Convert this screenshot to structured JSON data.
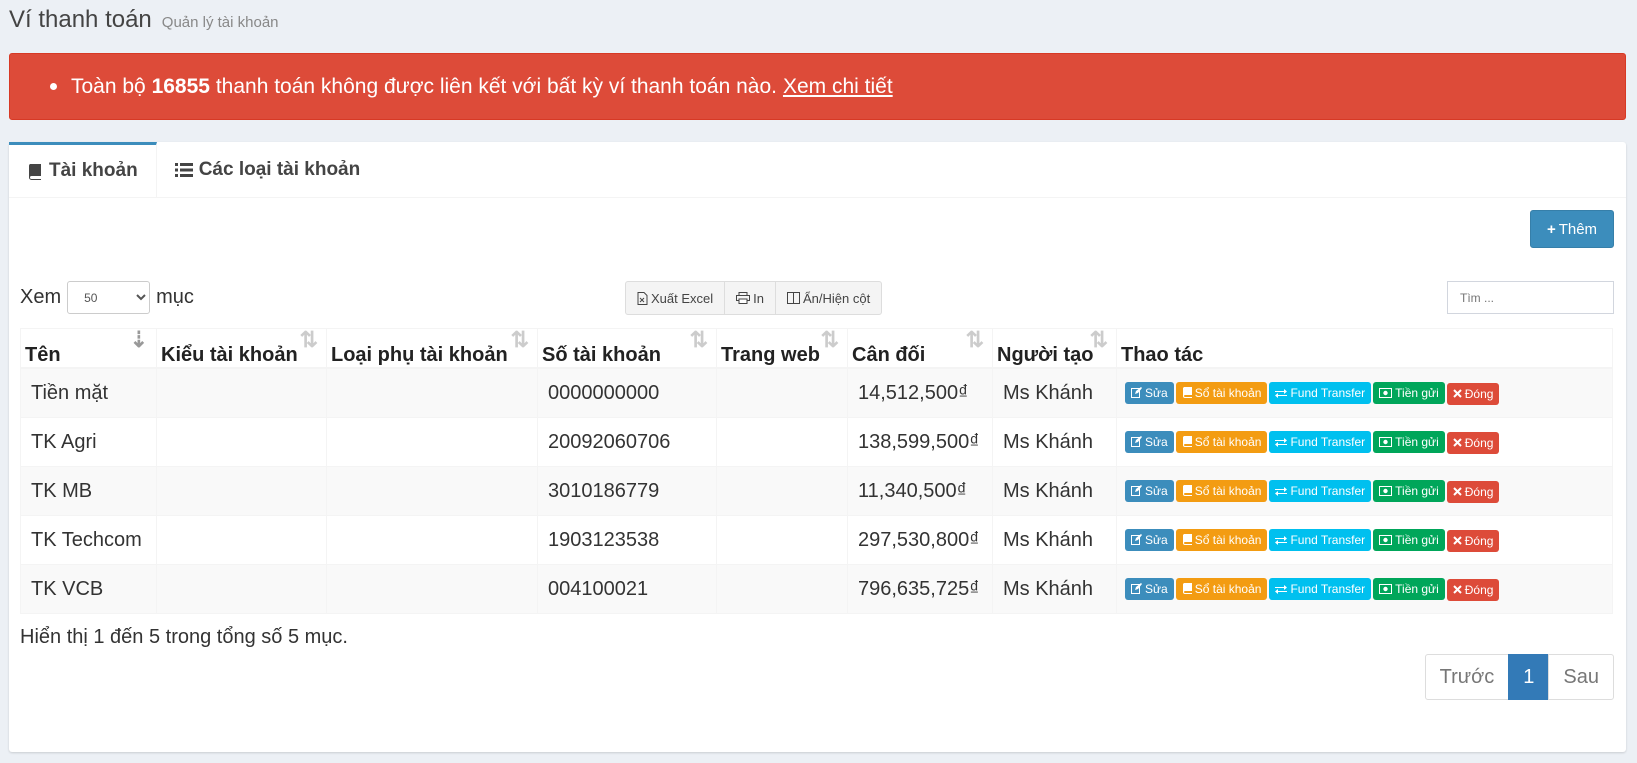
{
  "header": {
    "title": "Ví thanh toán",
    "subtitle": "Quản lý tài khoản"
  },
  "alert": {
    "before": "Toàn bộ",
    "count": "16855",
    "after": "thanh toán không được liên kết với bất kỳ ví thanh toán nào.",
    "link": "Xem chi tiết",
    "color": "#dd4b39"
  },
  "tabs": [
    {
      "label": "Tài khoản",
      "icon": "book-icon"
    },
    {
      "label": "Các loại tài khoản",
      "icon": "list-icon"
    }
  ],
  "add_button": "Thêm",
  "length": {
    "prefix": "Xem",
    "value": "50",
    "suffix": "mục"
  },
  "export_buttons": {
    "excel": "Xuất Excel",
    "print": "In",
    "columns": "Ẩn/Hiện cột"
  },
  "search": {
    "placeholder": "Tìm ..."
  },
  "table": {
    "headers": [
      "Tên",
      "Kiểu tài khoản",
      "Loại phụ tài khoản",
      "Số tài khoản",
      "Trang web",
      "Cân đối",
      "Người tạo",
      "Thao tác"
    ],
    "rows": [
      {
        "name": "Tiền mặt",
        "type": "",
        "subtype": "",
        "account_no": "0000000000",
        "website": "",
        "balance": "14,512,500₫",
        "creator": "Ms Khánh"
      },
      {
        "name": "TK Agri",
        "type": "",
        "subtype": "",
        "account_no": "20092060706",
        "website": "",
        "balance": "138,599,500₫",
        "creator": "Ms Khánh"
      },
      {
        "name": "TK MB",
        "type": "",
        "subtype": "",
        "account_no": "3010186779",
        "website": "",
        "balance": "11,340,500₫",
        "creator": "Ms Khánh"
      },
      {
        "name": "TK Techcom",
        "type": "",
        "subtype": "",
        "account_no": "1903123538",
        "website": "",
        "balance": "297,530,800₫",
        "creator": "Ms Khánh"
      },
      {
        "name": "TK VCB",
        "type": "",
        "subtype": "",
        "account_no": "004100021",
        "website": "",
        "balance": "796,635,725₫",
        "creator": "Ms Khánh"
      }
    ],
    "actions": {
      "edit": "Sửa",
      "ledger": "Sổ tài khoản",
      "transfer": "Fund Transfer",
      "deposit": "Tiền gửi",
      "close": "Đóng"
    }
  },
  "info": "Hiển thị 1 đến 5 trong tổng số 5 mục.",
  "pagination": {
    "prev": "Trước",
    "current": "1",
    "next": "Sau"
  }
}
